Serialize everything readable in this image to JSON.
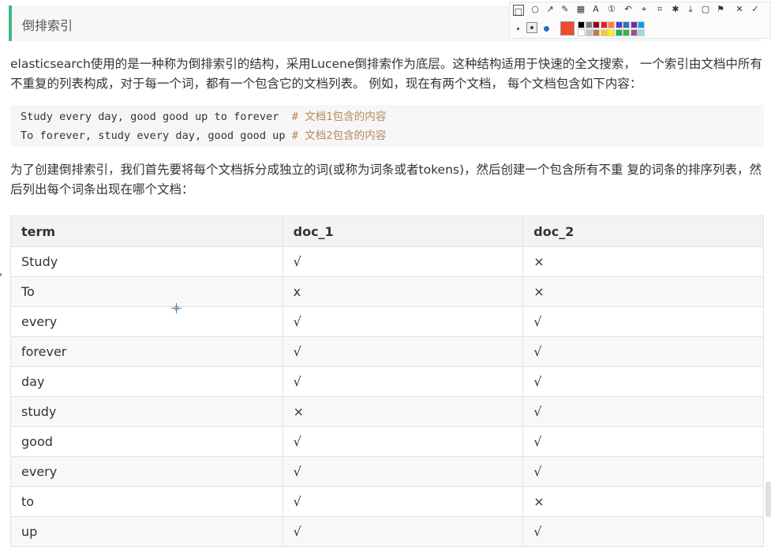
{
  "heading": "倒排索引",
  "intro_paragraph": "elasticsearch使用的是一种称为倒排索引的结构，采用Lucene倒排索作为底层。这种结构适用于快速的全文搜索， 一个索引由文档中所有不重复的列表构成，对于每一个词，都有一个包含它的文档列表。 例如，现在有两个文档， 每个文档包含如下内容：",
  "code_lines": [
    {
      "code": "Study every day, good good up to forever  ",
      "comment": "# 文档1包含的内容"
    },
    {
      "code": "To forever, study every day, good good up ",
      "comment": "# 文档2包含的内容"
    }
  ],
  "second_paragraph": "为了创建倒排索引，我们首先要将每个文档拆分成独立的词(或称为词条或者tokens)，然后创建一个包含所有不重 复的词条的排序列表，然后列出每个词条出现在哪个文档：",
  "table": {
    "headers": [
      "term",
      "doc_1",
      "doc_2"
    ],
    "rows": [
      [
        "Study",
        "√",
        "×"
      ],
      [
        "To",
        "x",
        "×"
      ],
      [
        "every",
        "√",
        "√"
      ],
      [
        "forever",
        "√",
        "√"
      ],
      [
        "day",
        "√",
        "√"
      ],
      [
        "study",
        "×",
        "√"
      ],
      [
        "good",
        "√",
        "√"
      ],
      [
        "every",
        "√",
        "√"
      ],
      [
        "to",
        "√",
        "×"
      ],
      [
        "up",
        "√",
        "√"
      ]
    ]
  },
  "toolbar": {
    "tools": [
      "rectangle-tool",
      "ellipse-tool",
      "arrow-tool",
      "pen-tool",
      "mosaic-tool",
      "text-tool",
      "number-tool",
      "undo-tool",
      "pin-tool",
      "ocr-tool",
      "stick-tool",
      "save-tool",
      "copy-tool",
      "bookmark-tool",
      "close-tool",
      "confirm-tool"
    ],
    "selected_color": "#f04a2f",
    "palette": [
      "#000000",
      "#7f7f7f",
      "#880015",
      "#ed1c24",
      "#ff7f27",
      "#3f48cc",
      "#2e75b6",
      "#7030a0",
      "#00a2e8",
      "#ffffff",
      "#c3c3c3",
      "#b97a57",
      "#ffc90e",
      "#fff200",
      "#22b14c",
      "#3bb054",
      "#a349a4",
      "#99d9ea"
    ]
  }
}
